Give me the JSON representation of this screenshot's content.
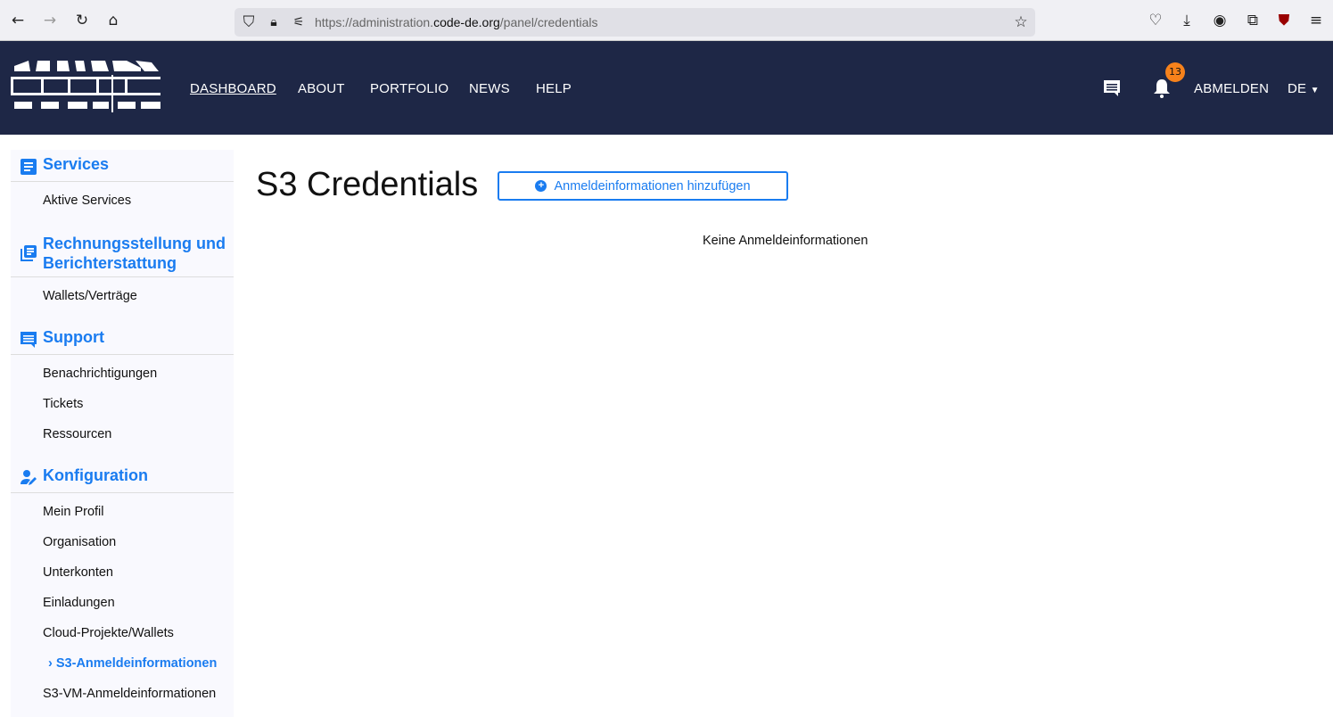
{
  "browser": {
    "url_prefix": "https://administration.",
    "url_domain": "code-de.org",
    "url_path": "/panel/credentials"
  },
  "nav": {
    "logo_text": "CODE-DE",
    "links": [
      "DASHBOARD",
      "ABOUT",
      "PORTFOLIO",
      "NEWS",
      "HELP"
    ],
    "notification_count": "13",
    "logout": "ABMELDEN",
    "language": "DE"
  },
  "sidebar": {
    "services": {
      "title": "Services",
      "items": [
        "Aktive Services"
      ]
    },
    "billing": {
      "title_line1": "Rechnungsstellung und",
      "title_line2": "Berichterstattung",
      "items": [
        "Wallets/Verträge"
      ]
    },
    "support": {
      "title": "Support",
      "items": [
        "Benachrichtigungen",
        "Tickets",
        "Ressourcen"
      ]
    },
    "config": {
      "title": "Konfiguration",
      "items": [
        "Mein Profil",
        "Organisation",
        "Unterkonten",
        "Einladungen",
        "Cloud-Projekte/Wallets",
        "S3-Anmeldeinformationen",
        "S3-VM-Anmeldeinformationen"
      ],
      "active_index": 5
    }
  },
  "main": {
    "title": "S3 Credentials",
    "add_button": "Anmeldeinformationen hinzufügen",
    "empty_text": "Keine Anmeldeinformationen"
  },
  "colors": {
    "nav_bg": "#1e2746",
    "accent": "#1a7cf0",
    "badge": "#f7821b"
  }
}
